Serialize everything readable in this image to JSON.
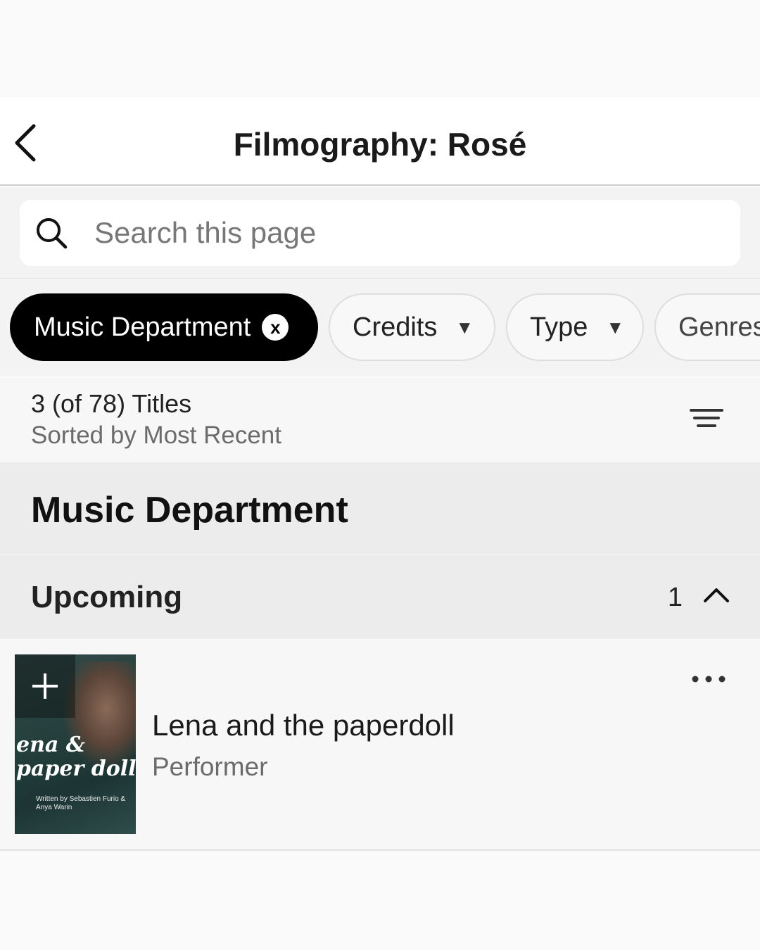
{
  "header": {
    "title": "Filmography: Rosé"
  },
  "search": {
    "placeholder": "Search this page"
  },
  "filters": {
    "active": {
      "label": "Music Department",
      "clear_symbol": "x"
    },
    "chips": [
      {
        "label": "Credits"
      },
      {
        "label": "Type"
      },
      {
        "label": "Genres"
      }
    ],
    "caret": "▼"
  },
  "summary": {
    "count": "3 (of 78) Titles",
    "sort": "Sorted by Most Recent"
  },
  "section": {
    "title": "Music Department"
  },
  "group": {
    "title": "Upcoming",
    "count": "1"
  },
  "items": [
    {
      "title": "Lena and the paperdoll",
      "role": "Performer",
      "poster": {
        "title_line1": "ena &",
        "title_line2": "paper doll",
        "credit": "Written by Sebastien Furio & Anya Warin"
      }
    }
  ],
  "icons": {
    "back": "chevron-left-icon",
    "search": "search-icon",
    "sort": "sort-icon",
    "collapse": "chevron-up-icon",
    "more": "more-horizontal-icon",
    "add": "plus-icon"
  }
}
